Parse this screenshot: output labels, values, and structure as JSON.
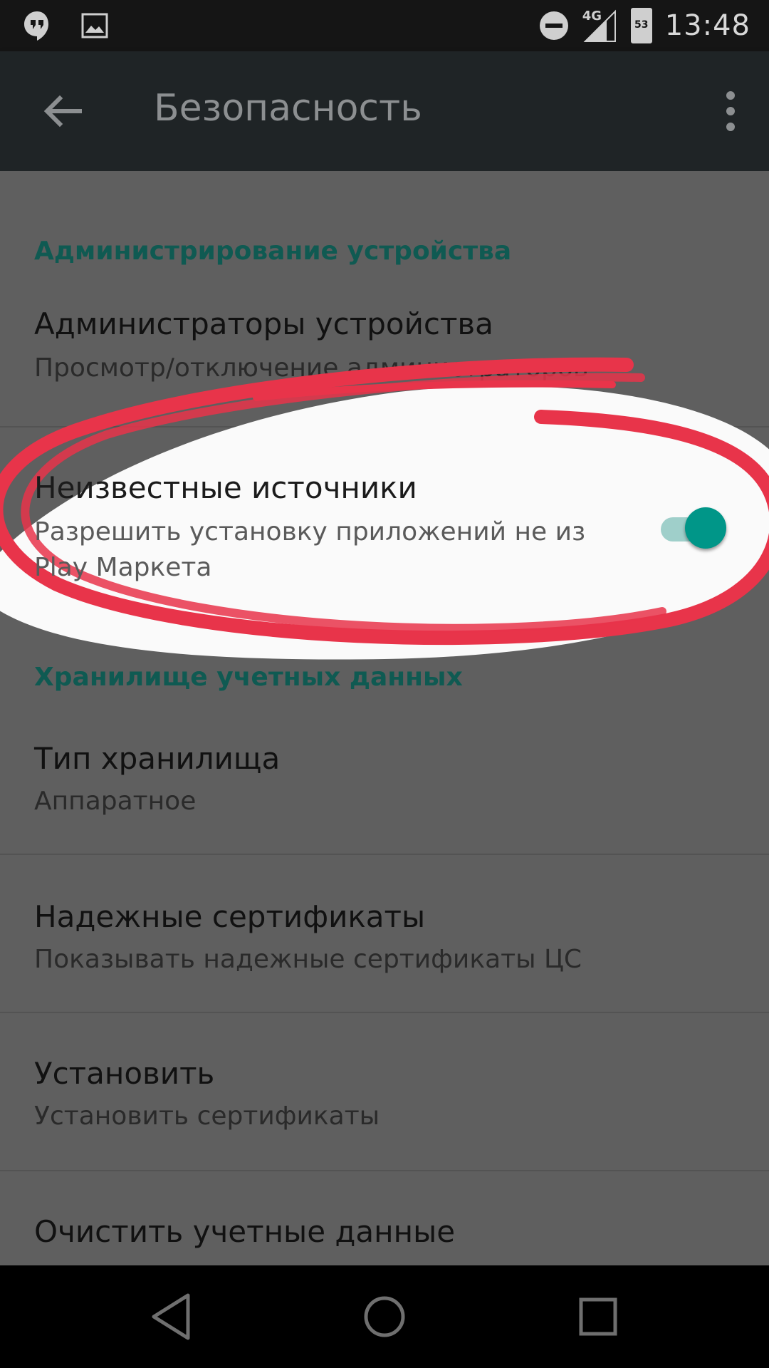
{
  "status_bar": {
    "network": "4G",
    "battery_level": "53",
    "time": "13:48",
    "left_icons": [
      "hangouts-icon",
      "image-icon"
    ],
    "right_icons": [
      "do-not-disturb-icon",
      "signal-icon",
      "battery-icon"
    ]
  },
  "app_bar": {
    "title": "Безопасность"
  },
  "sections": {
    "device_admin": {
      "header": "Администрирование устройства",
      "items": [
        {
          "title": "Администраторы устройства",
          "subtitle": "Просмотр/отключение администраторов"
        }
      ]
    },
    "unknown_sources": {
      "title": "Неизвестные источники",
      "subtitle": "Разрешить установку приложений не из Play Маркета",
      "enabled": true
    },
    "credential_storage": {
      "header": "Хранилище учетных данных",
      "items": [
        {
          "title": "Тип хранилища",
          "subtitle": "Аппаратное"
        },
        {
          "title": "Надежные сертификаты",
          "subtitle": "Показывать надежные сертификаты ЦС"
        },
        {
          "title": "Установить",
          "subtitle": "Установить сертификаты"
        },
        {
          "title": "Очистить учетные данные",
          "subtitle": ""
        }
      ]
    }
  },
  "colors": {
    "accent": "#009688",
    "accent_track": "#9fcfca",
    "section_header": "#0f5a52",
    "highlight_ring": "#e8344a"
  },
  "nav_bar": [
    "back-icon",
    "home-icon",
    "recents-icon"
  ]
}
